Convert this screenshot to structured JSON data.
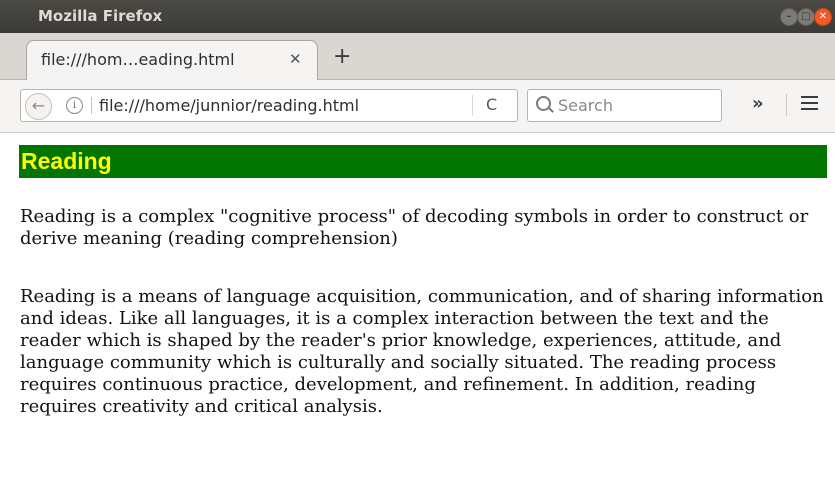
{
  "window": {
    "title": "Mozilla Firefox"
  },
  "tabs": [
    {
      "label": "file:///hom…eading.html",
      "active": true
    }
  ],
  "toolbar": {
    "url": "file:///home/junnior/reading.html",
    "search_placeholder": "Search",
    "overflow_label": "»",
    "reload_label": "C"
  },
  "page": {
    "heading": "Reading",
    "paragraphs": [
      "Reading is a complex \"cognitive process\" of decoding symbols in order to construct or derive meaning (reading comprehension)",
      "Reading is a means of language acquisition, communication, and of sharing information and ideas. Like all languages, it is a complex interaction between the text and the reader which is shaped by the reader's prior knowledge, experiences, attitude, and language community which is culturally and socially situated. The reading process requires continuous practice, development, and refinement. In addition, reading requires creativity and critical analysis."
    ]
  },
  "colors": {
    "heading_background": "#007500",
    "heading_text": "#ffff00",
    "close_button": "#f05a2b"
  },
  "icons": [
    "back-arrow-icon",
    "info-icon",
    "reload-icon",
    "search-icon",
    "overflow-icon",
    "hamburger-menu-icon",
    "tab-close-icon",
    "new-tab-icon"
  ]
}
